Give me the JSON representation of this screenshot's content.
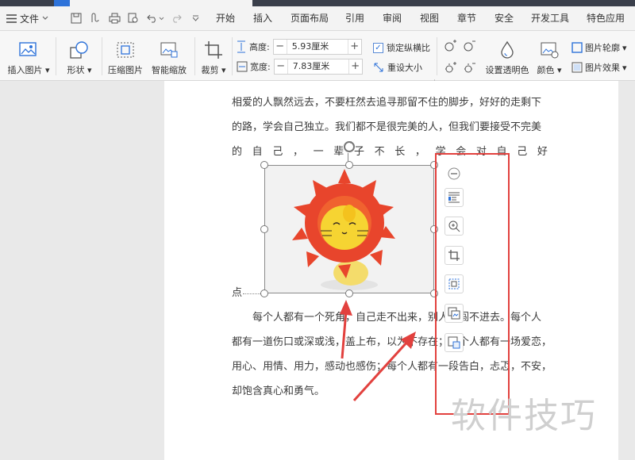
{
  "menu": {
    "file_label": "文件",
    "tabs": [
      "开始",
      "插入",
      "页面布局",
      "引用",
      "审阅",
      "视图",
      "章节",
      "安全",
      "开发工具",
      "特色应用"
    ]
  },
  "ribbon": {
    "insert_picture": "插入图片",
    "shape": "形状",
    "compress": "压缩图片",
    "smart_zoom": "智能缩放",
    "crop": "裁剪",
    "height_label": "高度:",
    "height_value": "5.93厘米",
    "width_label": "宽度:",
    "width_value": "7.83厘米",
    "lock_ratio": "锁定纵横比",
    "reset_size": "重设大小",
    "transparent": "设置透明色",
    "color": "颜色",
    "outline": "图片轮廓",
    "effects": "图片效果"
  },
  "document": {
    "line1": "相爱的人飘然远去，不要枉然去追寻那留不住的脚步，好好的走剩下",
    "line2": "的路，学会自己独立。我们都不是很完美的人，但我们要接受不完美",
    "line3_chars": [
      "的",
      "自",
      "己",
      "，",
      "一",
      "辈",
      "子",
      "不",
      "长",
      "，",
      "学",
      "会",
      "对",
      "自",
      "己",
      "好"
    ],
    "line4": "点",
    "line5": "每个人都有一个死角，自己走不出来，别人也闯不进去。每个人",
    "line6": "都有一道伤口或深或浅，盖上布，以为不存在；每个人都有一场爱恋，",
    "line7": "用心、用情、用力，感动也感伤；每个人都有一段告白，忐忑，不安，",
    "line8": "却饱含真心和勇气。"
  },
  "watermark": "软件技巧",
  "colors": {
    "accent": "#2d72d9",
    "annotation": "#e2413e",
    "lion_mane": "#e8452c",
    "lion_face": "#f5d53a"
  }
}
